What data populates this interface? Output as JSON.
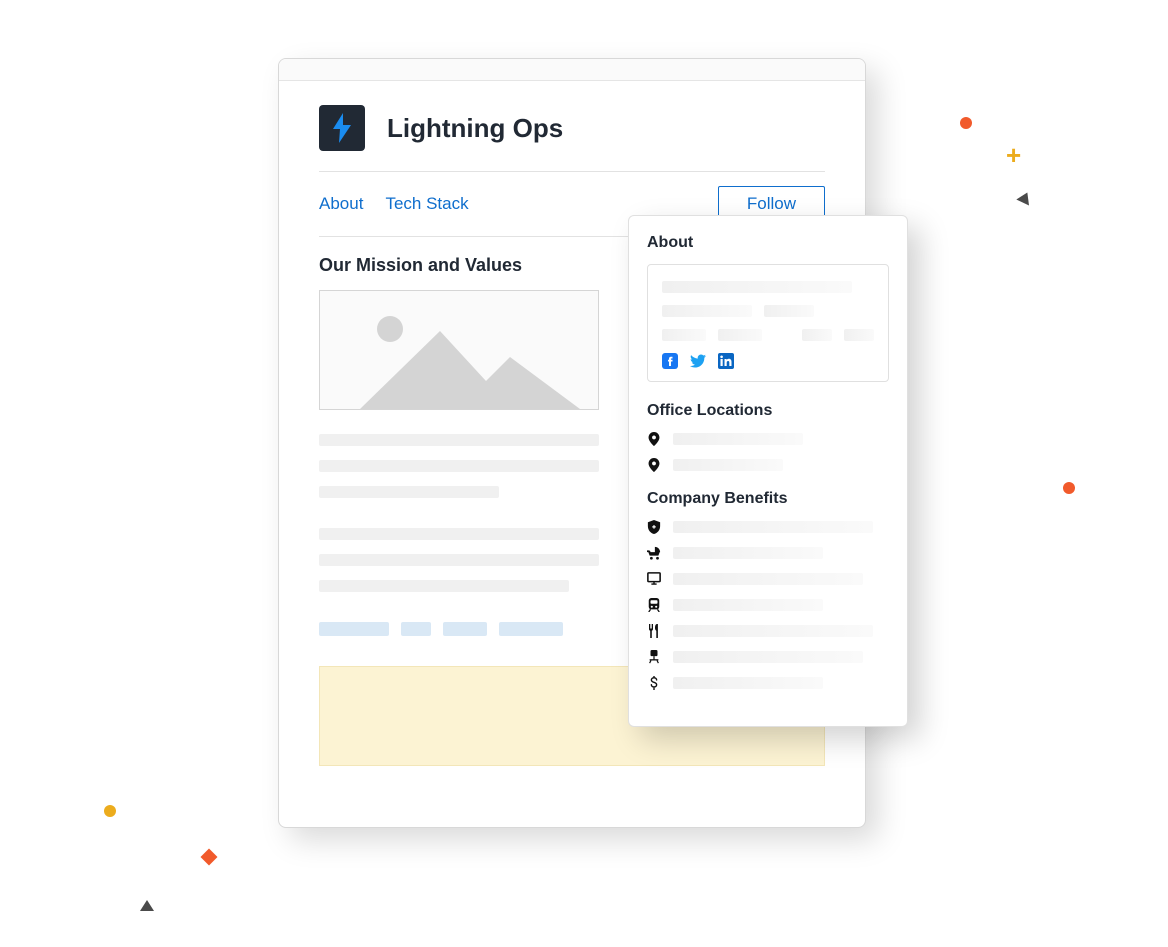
{
  "company": {
    "name": "Lightning Ops"
  },
  "tabs": {
    "about": "About",
    "tech_stack": "Tech Stack"
  },
  "follow_label": "Follow",
  "main": {
    "mission_title": "Our Mission and Values"
  },
  "sidebar": {
    "about_title": "About",
    "office_locations_title": "Office Locations",
    "company_benefits_title": "Company Benefits"
  }
}
